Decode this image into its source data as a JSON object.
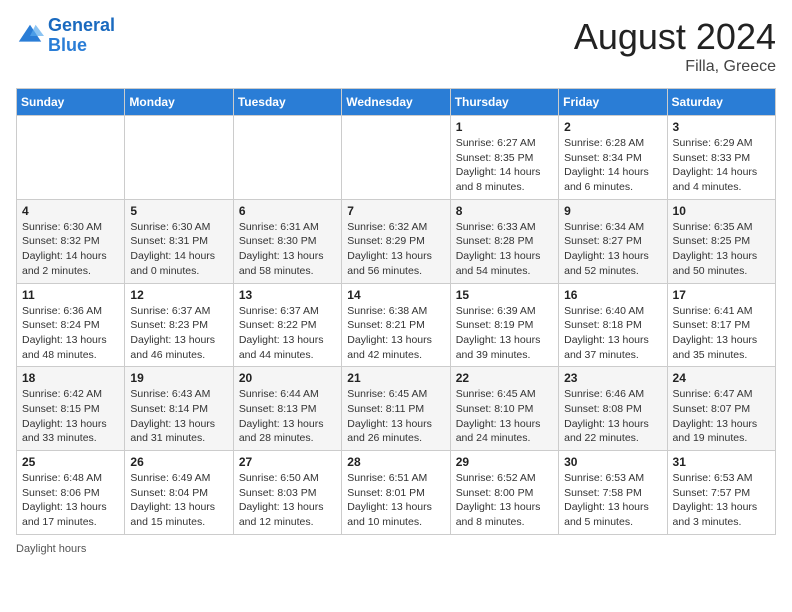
{
  "header": {
    "logo_line1": "General",
    "logo_line2": "Blue",
    "month_year": "August 2024",
    "location": "Filla, Greece"
  },
  "days_of_week": [
    "Sunday",
    "Monday",
    "Tuesday",
    "Wednesday",
    "Thursday",
    "Friday",
    "Saturday"
  ],
  "weeks": [
    [
      {
        "day": "",
        "info": ""
      },
      {
        "day": "",
        "info": ""
      },
      {
        "day": "",
        "info": ""
      },
      {
        "day": "",
        "info": ""
      },
      {
        "day": "1",
        "info": "Sunrise: 6:27 AM\nSunset: 8:35 PM\nDaylight: 14 hours and 8 minutes."
      },
      {
        "day": "2",
        "info": "Sunrise: 6:28 AM\nSunset: 8:34 PM\nDaylight: 14 hours and 6 minutes."
      },
      {
        "day": "3",
        "info": "Sunrise: 6:29 AM\nSunset: 8:33 PM\nDaylight: 14 hours and 4 minutes."
      }
    ],
    [
      {
        "day": "4",
        "info": "Sunrise: 6:30 AM\nSunset: 8:32 PM\nDaylight: 14 hours and 2 minutes."
      },
      {
        "day": "5",
        "info": "Sunrise: 6:30 AM\nSunset: 8:31 PM\nDaylight: 14 hours and 0 minutes."
      },
      {
        "day": "6",
        "info": "Sunrise: 6:31 AM\nSunset: 8:30 PM\nDaylight: 13 hours and 58 minutes."
      },
      {
        "day": "7",
        "info": "Sunrise: 6:32 AM\nSunset: 8:29 PM\nDaylight: 13 hours and 56 minutes."
      },
      {
        "day": "8",
        "info": "Sunrise: 6:33 AM\nSunset: 8:28 PM\nDaylight: 13 hours and 54 minutes."
      },
      {
        "day": "9",
        "info": "Sunrise: 6:34 AM\nSunset: 8:27 PM\nDaylight: 13 hours and 52 minutes."
      },
      {
        "day": "10",
        "info": "Sunrise: 6:35 AM\nSunset: 8:25 PM\nDaylight: 13 hours and 50 minutes."
      }
    ],
    [
      {
        "day": "11",
        "info": "Sunrise: 6:36 AM\nSunset: 8:24 PM\nDaylight: 13 hours and 48 minutes."
      },
      {
        "day": "12",
        "info": "Sunrise: 6:37 AM\nSunset: 8:23 PM\nDaylight: 13 hours and 46 minutes."
      },
      {
        "day": "13",
        "info": "Sunrise: 6:37 AM\nSunset: 8:22 PM\nDaylight: 13 hours and 44 minutes."
      },
      {
        "day": "14",
        "info": "Sunrise: 6:38 AM\nSunset: 8:21 PM\nDaylight: 13 hours and 42 minutes."
      },
      {
        "day": "15",
        "info": "Sunrise: 6:39 AM\nSunset: 8:19 PM\nDaylight: 13 hours and 39 minutes."
      },
      {
        "day": "16",
        "info": "Sunrise: 6:40 AM\nSunset: 8:18 PM\nDaylight: 13 hours and 37 minutes."
      },
      {
        "day": "17",
        "info": "Sunrise: 6:41 AM\nSunset: 8:17 PM\nDaylight: 13 hours and 35 minutes."
      }
    ],
    [
      {
        "day": "18",
        "info": "Sunrise: 6:42 AM\nSunset: 8:15 PM\nDaylight: 13 hours and 33 minutes."
      },
      {
        "day": "19",
        "info": "Sunrise: 6:43 AM\nSunset: 8:14 PM\nDaylight: 13 hours and 31 minutes."
      },
      {
        "day": "20",
        "info": "Sunrise: 6:44 AM\nSunset: 8:13 PM\nDaylight: 13 hours and 28 minutes."
      },
      {
        "day": "21",
        "info": "Sunrise: 6:45 AM\nSunset: 8:11 PM\nDaylight: 13 hours and 26 minutes."
      },
      {
        "day": "22",
        "info": "Sunrise: 6:45 AM\nSunset: 8:10 PM\nDaylight: 13 hours and 24 minutes."
      },
      {
        "day": "23",
        "info": "Sunrise: 6:46 AM\nSunset: 8:08 PM\nDaylight: 13 hours and 22 minutes."
      },
      {
        "day": "24",
        "info": "Sunrise: 6:47 AM\nSunset: 8:07 PM\nDaylight: 13 hours and 19 minutes."
      }
    ],
    [
      {
        "day": "25",
        "info": "Sunrise: 6:48 AM\nSunset: 8:06 PM\nDaylight: 13 hours and 17 minutes."
      },
      {
        "day": "26",
        "info": "Sunrise: 6:49 AM\nSunset: 8:04 PM\nDaylight: 13 hours and 15 minutes."
      },
      {
        "day": "27",
        "info": "Sunrise: 6:50 AM\nSunset: 8:03 PM\nDaylight: 13 hours and 12 minutes."
      },
      {
        "day": "28",
        "info": "Sunrise: 6:51 AM\nSunset: 8:01 PM\nDaylight: 13 hours and 10 minutes."
      },
      {
        "day": "29",
        "info": "Sunrise: 6:52 AM\nSunset: 8:00 PM\nDaylight: 13 hours and 8 minutes."
      },
      {
        "day": "30",
        "info": "Sunrise: 6:53 AM\nSunset: 7:58 PM\nDaylight: 13 hours and 5 minutes."
      },
      {
        "day": "31",
        "info": "Sunrise: 6:53 AM\nSunset: 7:57 PM\nDaylight: 13 hours and 3 minutes."
      }
    ]
  ],
  "footer": {
    "daylight_label": "Daylight hours"
  }
}
